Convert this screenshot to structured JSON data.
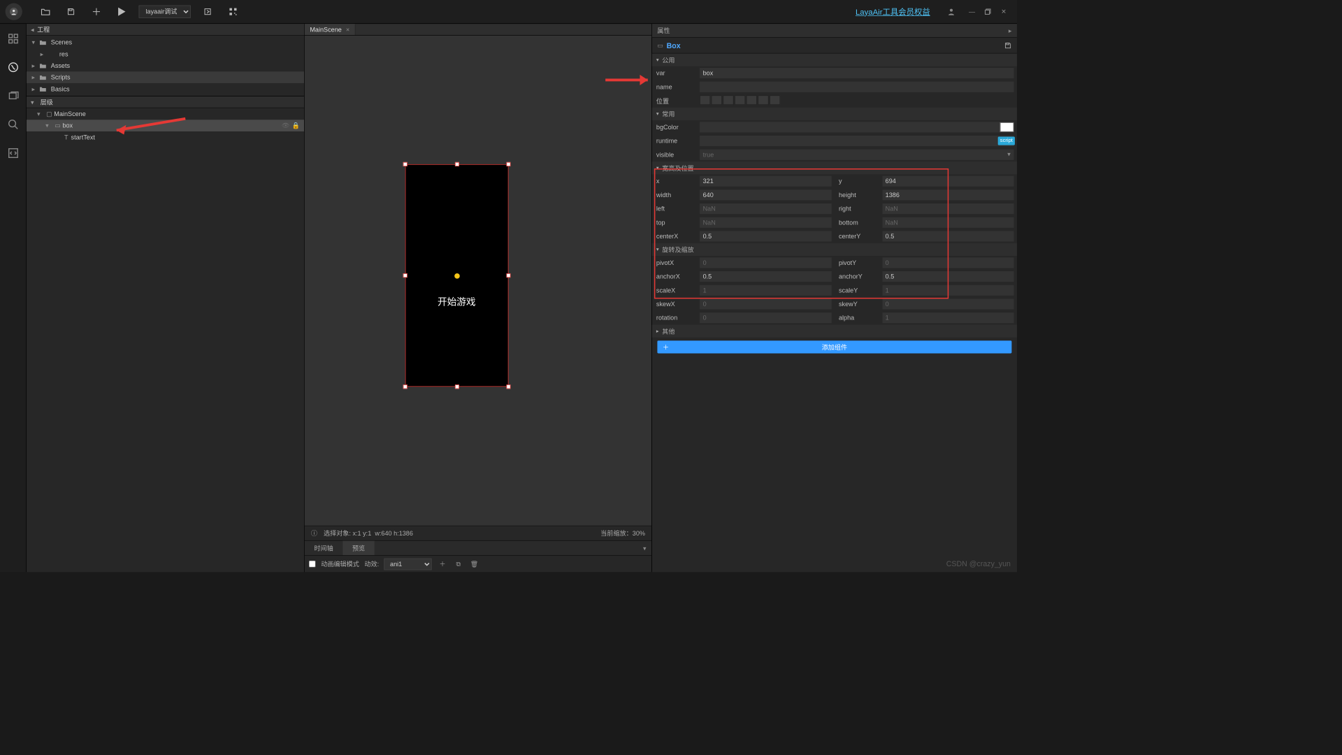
{
  "topbar": {
    "debug_options": [
      "layaair调试"
    ],
    "debug_selected": "layaair调试",
    "link_text": "LayaAir工具会员权益"
  },
  "project_panel": {
    "title": "工程",
    "tree": [
      {
        "label": "Scenes",
        "icon": "folder",
        "expand": true,
        "depth": 0
      },
      {
        "label": "res",
        "icon": "",
        "expand": false,
        "depth": 1
      },
      {
        "label": "Assets",
        "icon": "folder",
        "expand": false,
        "depth": 0
      },
      {
        "label": "Scripts",
        "icon": "folder",
        "expand": false,
        "depth": 0,
        "selected": true
      },
      {
        "label": "Basics",
        "icon": "folder",
        "expand": false,
        "depth": 0
      }
    ]
  },
  "hierarchy_panel": {
    "title": "层级",
    "tree": [
      {
        "label": "MainScene",
        "icon": "scene",
        "depth": 0,
        "expand": true
      },
      {
        "label": "box",
        "icon": "box",
        "depth": 1,
        "expand": true,
        "selected": true
      },
      {
        "label": "startText",
        "icon": "text",
        "depth": 2
      }
    ]
  },
  "center": {
    "tab_label": "MainScene",
    "game_text": "开始游戏",
    "status_prefix": "选择对象:",
    "status_coords": "x:1 y:1",
    "status_size": "w:640 h:1386",
    "zoom_label": "当前缩放：",
    "zoom_value": "30%",
    "timeline_tab1": "时间轴",
    "timeline_tab2": "预览",
    "ani_mode": "动画编辑模式",
    "ani_fx": "动效:",
    "ani_options": [
      "ani1"
    ],
    "ani_selected": "ani1"
  },
  "props": {
    "panel_title": "属性",
    "obj_type": "Box",
    "sections": {
      "public": "公用",
      "common": "常用",
      "size_pos": "宽高及位置",
      "rot_scale": "旋转及缩放",
      "other": "其他"
    },
    "labels": {
      "var": "var",
      "name": "name",
      "pos": "位置",
      "bgColor": "bgColor",
      "runtime": "runtime",
      "visible": "visible",
      "x": "x",
      "y": "y",
      "width": "width",
      "height": "height",
      "left": "left",
      "right": "right",
      "top": "top",
      "bottom": "bottom",
      "centerX": "centerX",
      "centerY": "centerY",
      "pivotX": "pivotX",
      "pivotY": "pivotY",
      "anchorX": "anchorX",
      "anchorY": "anchorY",
      "scaleX": "scaleX",
      "scaleY": "scaleY",
      "skewX": "skewX",
      "skewY": "skewY",
      "rotation": "rotation",
      "alpha": "alpha"
    },
    "values": {
      "var": "box",
      "name": "",
      "visible": "true",
      "x": "321",
      "y": "694",
      "width": "640",
      "height": "1386",
      "left": "NaN",
      "right": "NaN",
      "top": "NaN",
      "bottom": "NaN",
      "centerX": "0.5",
      "centerY": "0.5",
      "pivotX": "0",
      "pivotY": "0",
      "anchorX": "0.5",
      "anchorY": "0.5",
      "scaleX": "1",
      "scaleY": "1",
      "skewX": "0",
      "skewY": "0",
      "rotation": "0",
      "alpha": "1"
    },
    "script_badge": "script",
    "add_component": "添加组件"
  },
  "watermark": "CSDN @crazy_yun"
}
